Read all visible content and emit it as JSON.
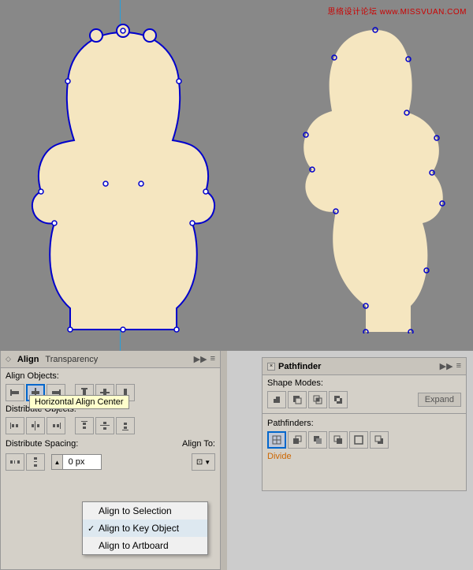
{
  "watermark": "思络设计论坛 www.MISSVUAN.COM",
  "canvas": {
    "bg": "#888888"
  },
  "align_panel": {
    "title": "Align",
    "tab2": "Transparency",
    "sections": {
      "align_objects": "Align Objects:",
      "distribute_objects": "Distribute Objects:",
      "distribute_spacing": "Distribute Spacing:",
      "align_to": "Align To:"
    },
    "tooltip": "Horizontal Align Center",
    "px_value": "0 px"
  },
  "pathfinder_panel": {
    "title": "Pathfinder",
    "shape_modes": "Shape Modes:",
    "pathfinders": "Pathfinders:",
    "expand_btn": "Expand",
    "divide_label": "Divide"
  },
  "dropdown": {
    "items": [
      {
        "label": "Align to Selection",
        "checked": false
      },
      {
        "label": "Align to Key Object",
        "checked": true
      },
      {
        "label": "Align to Artboard",
        "checked": false
      }
    ]
  }
}
